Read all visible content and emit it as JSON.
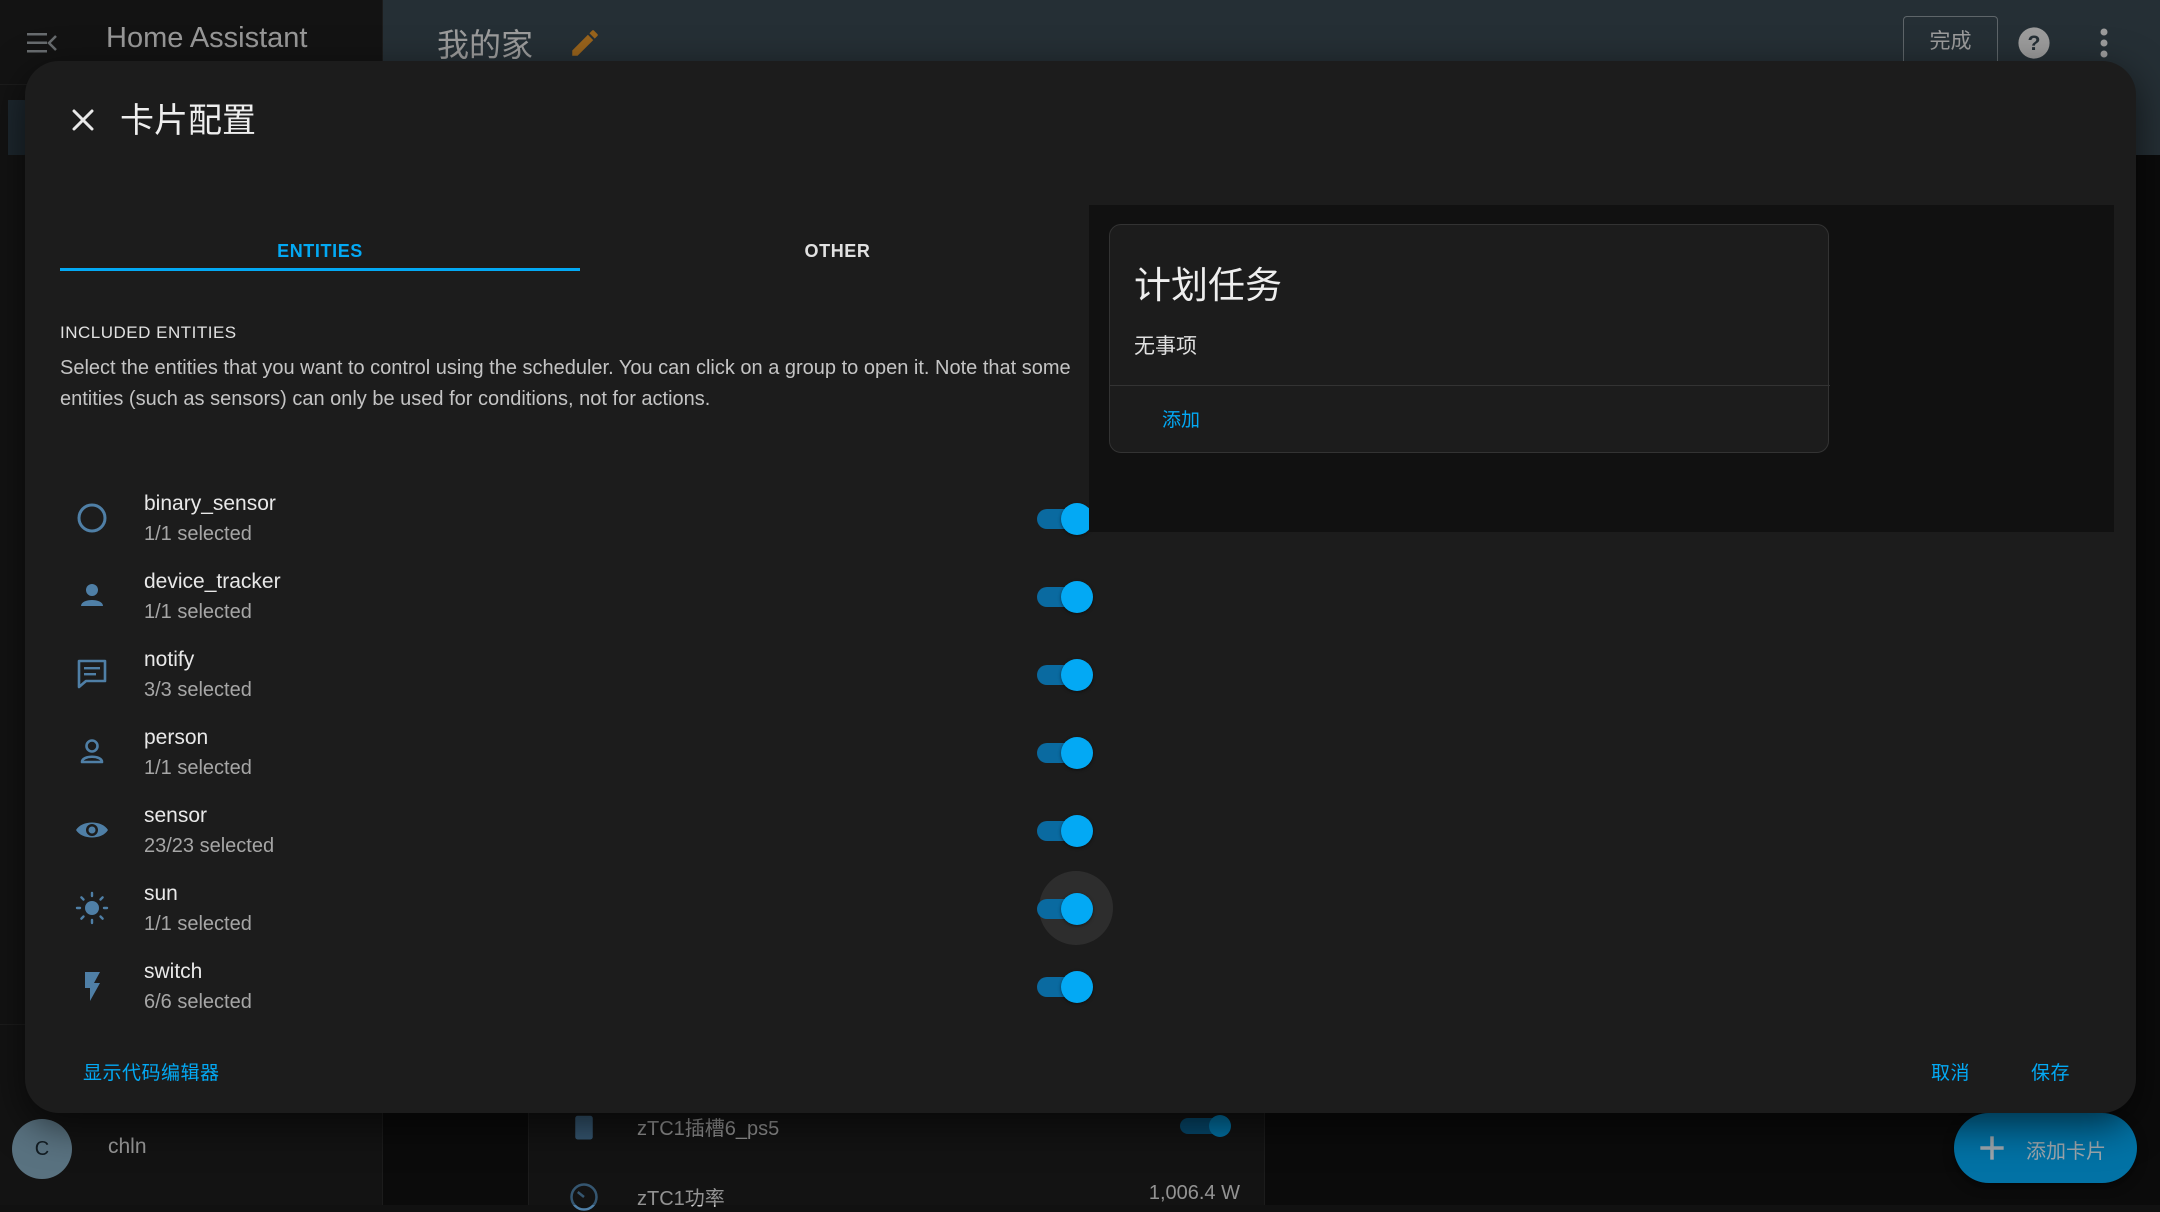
{
  "app": {
    "sidebar_title": "Home Assistant",
    "dashboard_title": "我的家",
    "done_label": "完成",
    "user_initial": "C",
    "user_name": "chln"
  },
  "background_card": {
    "row1_label": "zTC1插槽6_ps5",
    "row2_label": "zTC1功率",
    "row2_value": "1,006.4 W"
  },
  "fab": {
    "label": "添加卡片"
  },
  "dialog": {
    "title": "卡片配置",
    "tabs": [
      {
        "label": "ENTITIES",
        "active": true
      },
      {
        "label": "OTHER",
        "active": false
      }
    ],
    "section_heading": "INCLUDED ENTITIES",
    "section_description": "Select the entities that you want to control using the scheduler. You can click on a group to open it. Note that some entities (such as sensors) can only be used for conditions, not for actions.",
    "entities": [
      {
        "name": "binary_sensor",
        "count": "1/1 selected",
        "icon": "circle-outline-icon",
        "enabled": true
      },
      {
        "name": "device_tracker",
        "count": "1/1 selected",
        "icon": "account-icon",
        "enabled": true
      },
      {
        "name": "notify",
        "count": "3/3 selected",
        "icon": "message-text-icon",
        "enabled": true
      },
      {
        "name": "person",
        "count": "1/1 selected",
        "icon": "account-outline-icon",
        "enabled": true
      },
      {
        "name": "sensor",
        "count": "23/23 selected",
        "icon": "eye-icon",
        "enabled": true
      },
      {
        "name": "sun",
        "count": "1/1 selected",
        "icon": "sun-icon",
        "enabled": true,
        "focused": true
      },
      {
        "name": "switch",
        "count": "6/6 selected",
        "icon": "flash-icon",
        "enabled": true
      }
    ],
    "preview": {
      "title": "计划任务",
      "empty_text": "无事项",
      "add_label": "添加"
    },
    "actions": {
      "show_code_editor": "显示代码编辑器",
      "cancel": "取消",
      "save": "保存"
    }
  },
  "colors": {
    "accent": "#03a9f4",
    "dialog_bg": "#1c1c1c",
    "topbar_bg": "#37464f",
    "icon": "#4f7fa6"
  }
}
